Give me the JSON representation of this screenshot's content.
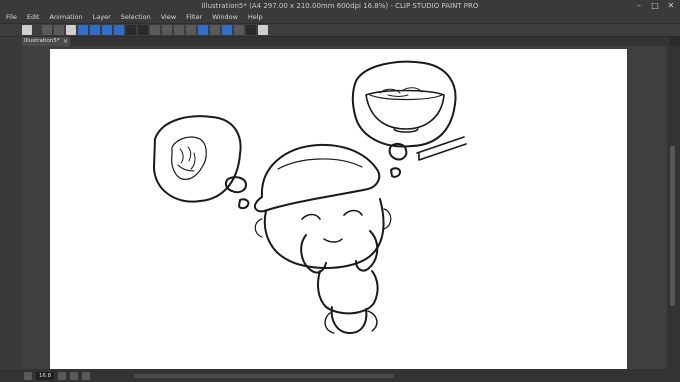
{
  "window": {
    "title": "Illustration5* (A4 297.00 x 210.00mm 600dpi 16.8%) - CLIP STUDIO PAINT PRO",
    "controls": [
      "minimize-icon",
      "maximize-icon",
      "close-icon"
    ]
  },
  "menu": {
    "items": [
      "File",
      "Edit",
      "Animation",
      "Layer",
      "Selection",
      "View",
      "Filter",
      "Window",
      "Help"
    ]
  },
  "toolbar": {
    "icons": [
      "eye-icon",
      "new-file-icon",
      "open-file-icon",
      "save-icon",
      "blue-tool-icon",
      "blue-tool-icon",
      "blue-tool-icon",
      "blue-tool-icon",
      "undo-icon",
      "redo-icon",
      "clear-icon",
      "transform-icon",
      "fill-icon",
      "clip-icon",
      "blue-ruler-icon",
      "layer-icon",
      "snap-icon",
      "pen-icon",
      "mortarboard-icon",
      "help-icon"
    ]
  },
  "tab": {
    "label": "Illustration5*"
  },
  "statusbar": {
    "zoom": "16.8"
  },
  "colors": {
    "chrome": "#3a3a3a",
    "canvas_bg": "#3f3f3f",
    "paper": "#ffffff",
    "ink": "#1a1a1a"
  }
}
